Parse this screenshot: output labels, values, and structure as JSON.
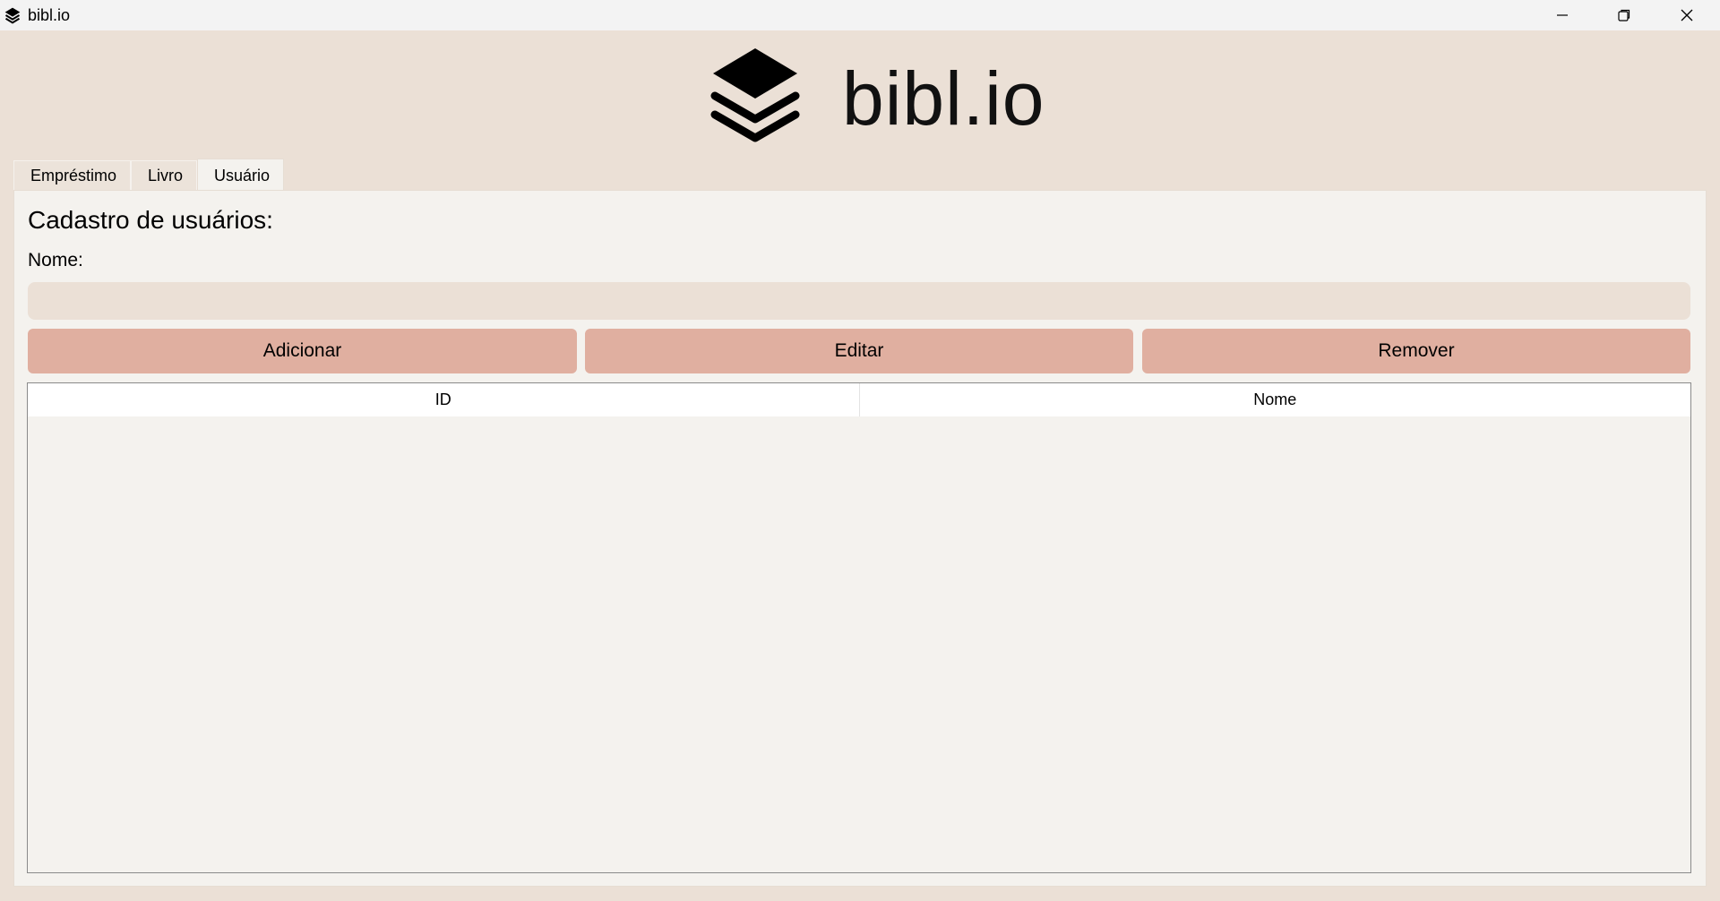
{
  "window": {
    "title": "bibl.io",
    "icon": "layers-icon",
    "controls": [
      "minimize-icon",
      "restore-icon",
      "close-icon"
    ]
  },
  "header": {
    "logo_icon": "layers-icon",
    "logo_text": "bibl.io"
  },
  "tabs": [
    {
      "label": "Empréstimo",
      "active": false
    },
    {
      "label": "Livro",
      "active": false
    },
    {
      "label": "Usuário",
      "active": true
    }
  ],
  "form": {
    "title": "Cadastro de usuários:",
    "name_label": "Nome:",
    "name_value": "",
    "name_placeholder": ""
  },
  "actions": {
    "add_label": "Adicionar",
    "edit_label": "Editar",
    "remove_label": "Remover"
  },
  "table": {
    "columns": [
      "ID",
      "Nome"
    ],
    "rows": []
  },
  "colors": {
    "background": "#ebe0d6",
    "panel": "#f4f2ee",
    "button": "#e0afa0",
    "input": "#ebe0d6"
  }
}
